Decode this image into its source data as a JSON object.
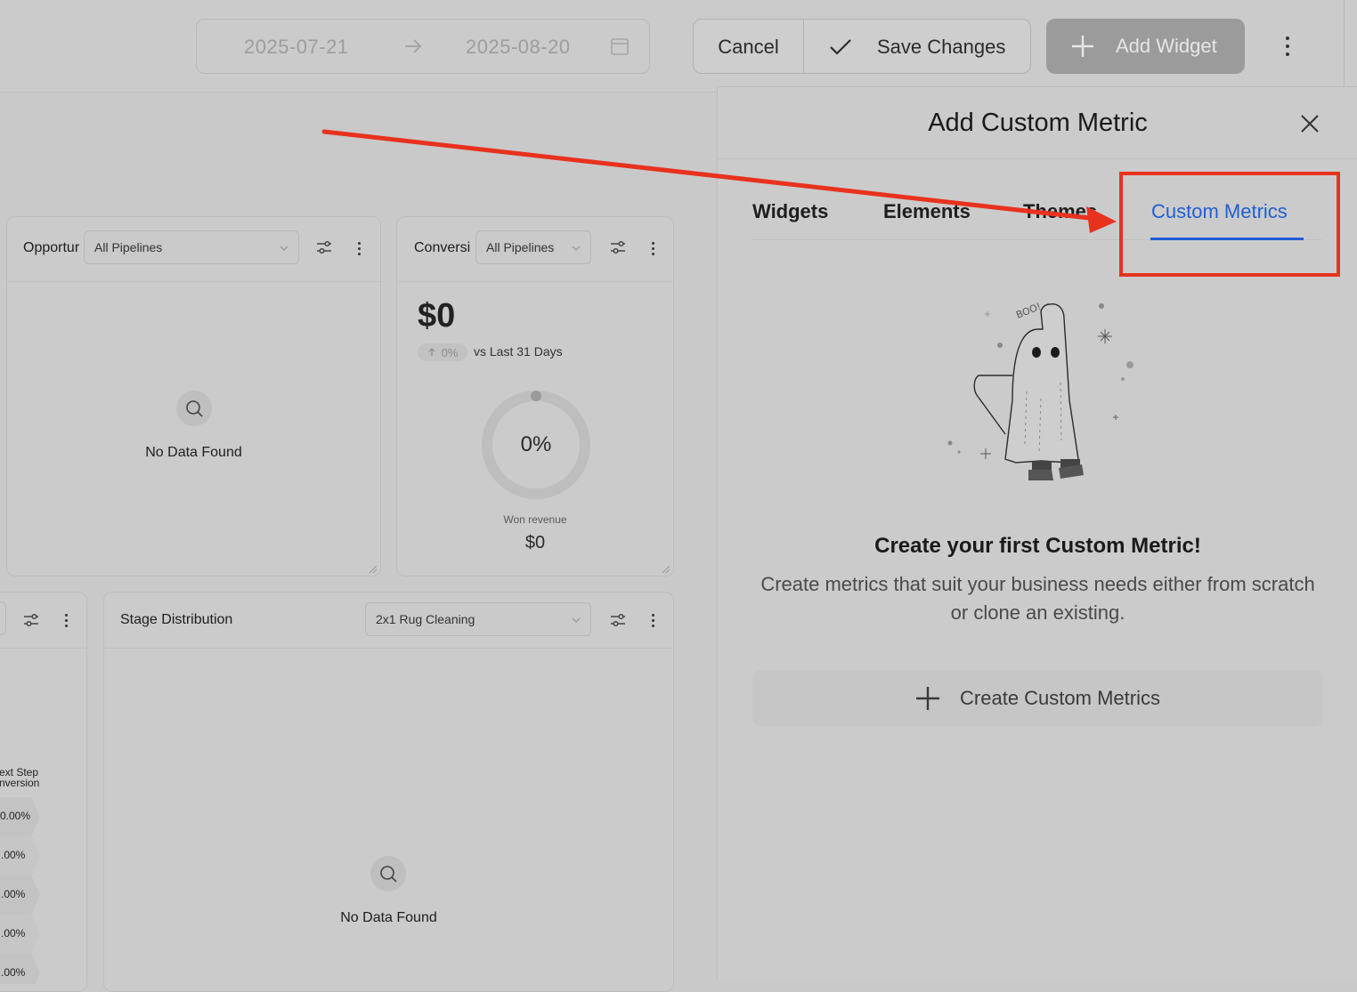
{
  "topbar": {
    "date_start": "2025-07-21",
    "date_end": "2025-08-20",
    "cancel_label": "Cancel",
    "save_label": "Save Changes",
    "add_widget_label": "Add Widget"
  },
  "cards": {
    "opportunities": {
      "title": "Opportur",
      "select": "All Pipelines",
      "empty": "No Data Found"
    },
    "conversion": {
      "title": "Conversi",
      "select": "All Pipelines",
      "value": "$0",
      "change": "0%",
      "compare": "vs Last 31 Days",
      "gauge_percent": "0%",
      "gauge_label": "Won revenue",
      "gauge_value": "$0"
    },
    "stage_distribution": {
      "title": "Stage Distribution",
      "select": "2x1 Rug Cleaning",
      "empty": "No Data Found"
    },
    "funnel": {
      "header_line1": "ext Step",
      "header_line2": "nversion",
      "percents": [
        "0.00%",
        ".00%",
        ".00%",
        ".00%",
        ".00%"
      ]
    }
  },
  "panel": {
    "title": "Add Custom Metric",
    "tabs": [
      "Widgets",
      "Elements",
      "Themes",
      "Custom Metrics"
    ],
    "active_tab": "Custom Metrics",
    "illustration_text": "BOO!",
    "empty_title": "Create your first Custom Metric!",
    "empty_desc": "Create metrics that suit your business needs either from scratch or clone an existing.",
    "create_button": "Create Custom Metrics"
  },
  "annotation": {
    "color": "#e8321e"
  },
  "colors": {
    "accent": "#1f5fd6",
    "overlay": "#c9c9c9"
  }
}
